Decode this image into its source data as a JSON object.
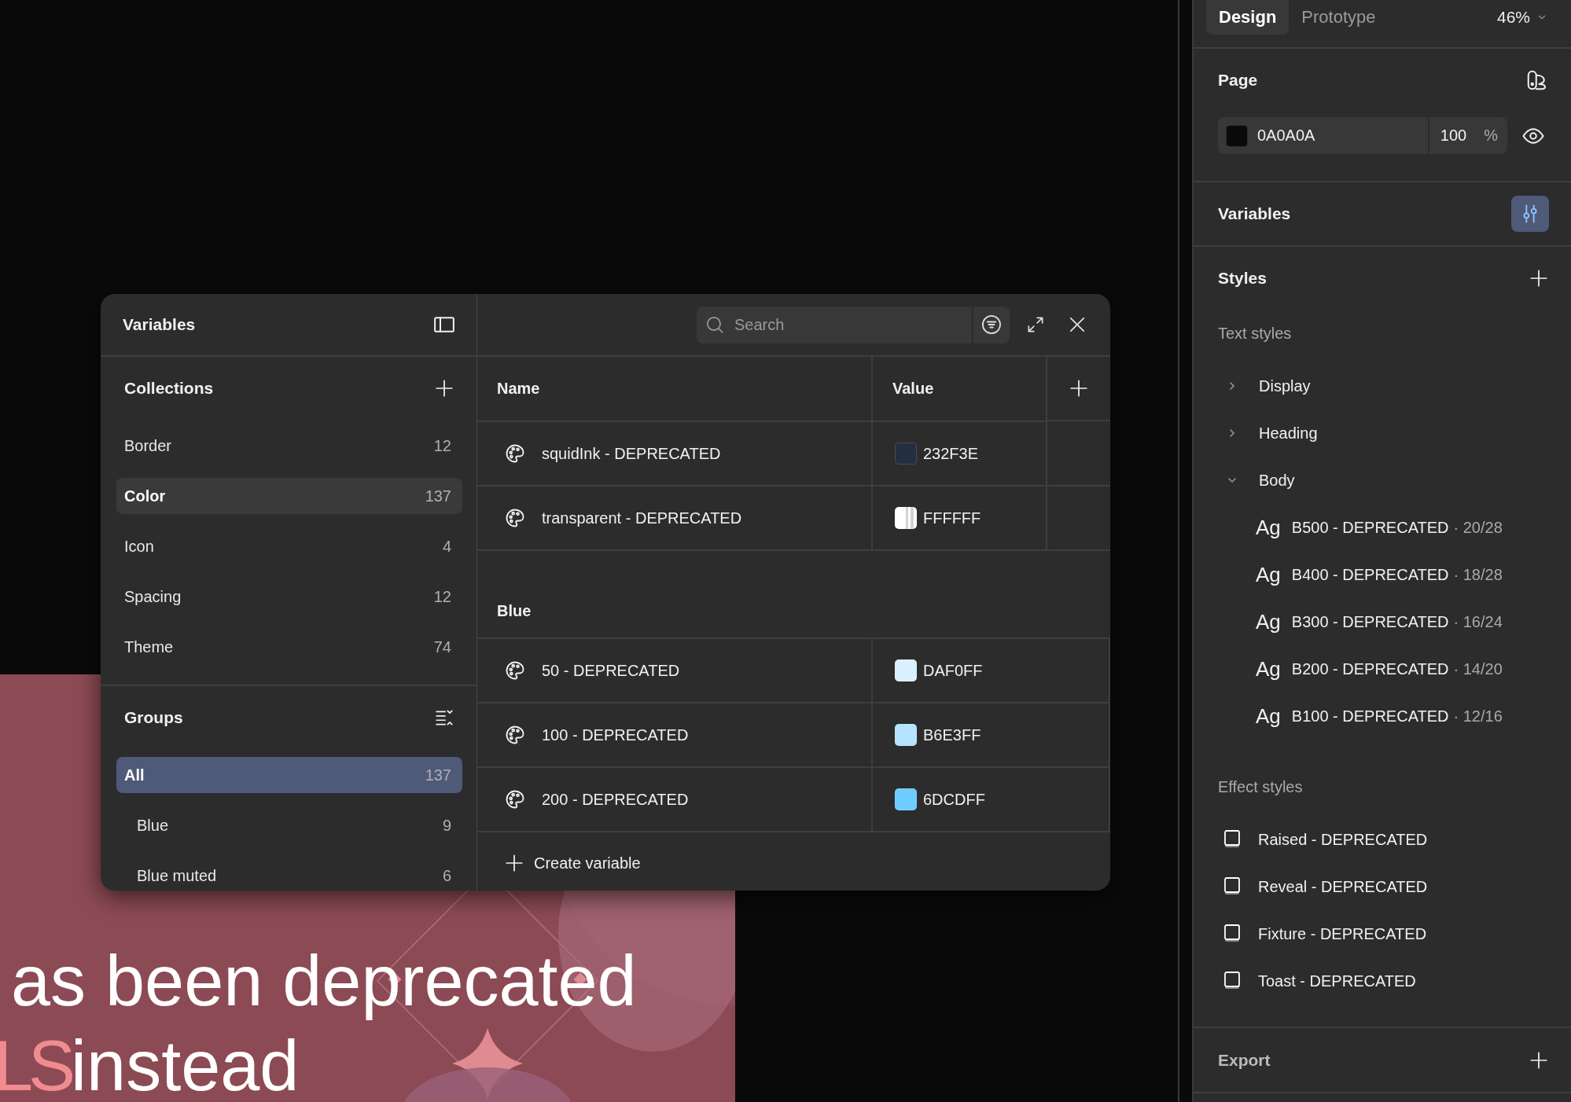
{
  "canvas": {
    "artboard": {
      "line_1": "as been deprecated",
      "line_2_accent": "LS",
      "line_2": "instead"
    }
  },
  "variables_dialog": {
    "title": "Variables",
    "search": {
      "placeholder": "Search"
    },
    "collections": {
      "title": "Collections",
      "items": [
        {
          "label": "Border",
          "count": "12",
          "selected": false
        },
        {
          "label": "Color",
          "count": "137",
          "selected": true
        },
        {
          "label": "Icon",
          "count": "4",
          "selected": false
        },
        {
          "label": "Spacing",
          "count": "12",
          "selected": false
        },
        {
          "label": "Theme",
          "count": "74",
          "selected": false
        }
      ]
    },
    "groups": {
      "title": "Groups",
      "items": [
        {
          "label": "All",
          "count": "137",
          "selected": true,
          "children": [
            {
              "label": "Blue",
              "count": "9",
              "selected": false
            },
            {
              "label": "Blue muted",
              "count": "6",
              "selected": false
            }
          ]
        }
      ]
    },
    "table": {
      "columns": [
        "Name",
        "Value"
      ],
      "sections": [
        {
          "rows": [
            {
              "name": "squidInk - DEPRECATED",
              "value": "232F3E",
              "kind": "solid",
              "color": "#232f3e"
            },
            {
              "name": "transparent - DEPRECATED",
              "value": "FFFFFF",
              "kind": "transparent",
              "color": "#ffffff"
            }
          ]
        },
        {
          "title": "Blue",
          "rows": [
            {
              "name": "50 - DEPRECATED",
              "value": "DAF0FF",
              "kind": "solid",
              "color": "#daf0ff"
            },
            {
              "name": "100 - DEPRECATED",
              "value": "B6E3FF",
              "kind": "solid",
              "color": "#b6e3ff"
            },
            {
              "name": "200 - DEPRECATED",
              "value": "6DCDFF",
              "kind": "solid",
              "color": "#6dcdff"
            }
          ]
        }
      ],
      "create_label": "Create variable"
    }
  },
  "right_panel": {
    "tabs": [
      {
        "label": "Design",
        "selected": true
      },
      {
        "label": "Prototype",
        "selected": false
      }
    ],
    "zoom": "46%",
    "page": {
      "title": "Page",
      "color": "#0a0a0a",
      "hex": "0A0A0A",
      "opacity": "100",
      "unit": "%"
    },
    "variables": {
      "title": "Variables",
      "open": true
    },
    "styles": {
      "title": "Styles",
      "text_styles_label": "Text styles",
      "text_groups": [
        {
          "label": "Display",
          "expanded": false
        },
        {
          "label": "Heading",
          "expanded": false
        },
        {
          "label": "Body",
          "expanded": true,
          "children": [
            {
              "preview": "Ag",
              "name": "B500 - DEPRECATED",
              "meta": "· 20/28"
            },
            {
              "preview": "Ag",
              "name": "B400 - DEPRECATED",
              "meta": "· 18/28"
            },
            {
              "preview": "Ag",
              "name": "B300 - DEPRECATED",
              "meta": "· 16/24"
            },
            {
              "preview": "Ag",
              "name": "B200 - DEPRECATED",
              "meta": "· 14/20"
            },
            {
              "preview": "Ag",
              "name": "B100 - DEPRECATED",
              "meta": "· 12/16"
            }
          ]
        }
      ],
      "effect_styles_label": "Effect styles",
      "effect_styles": [
        "Raised - DEPRECATED",
        "Reveal - DEPRECATED",
        "Fixture - DEPRECATED",
        "Toast - DEPRECATED"
      ]
    },
    "export": {
      "title": "Export"
    }
  }
}
